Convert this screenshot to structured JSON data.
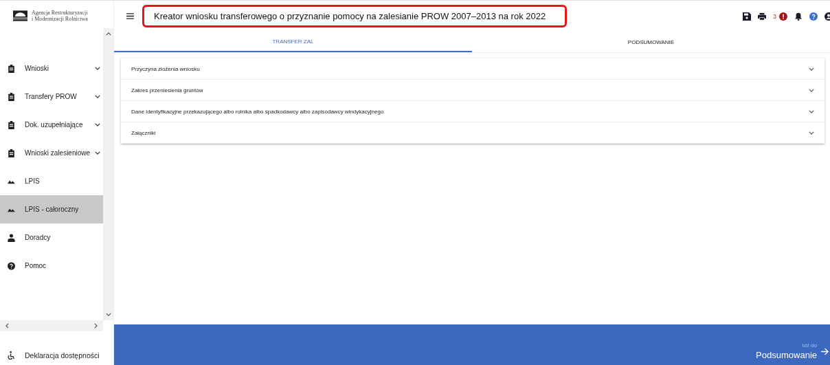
{
  "logo": {
    "line1": "Agencja Restrukturyzacji",
    "line2": "i Modernizacji Rolnictwa"
  },
  "sidebar": {
    "items": [
      {
        "label": "Wnioski",
        "kind": "clipboard",
        "expandable": true,
        "selected": false
      },
      {
        "label": "Transfery PROW",
        "kind": "clipboard",
        "expandable": true,
        "selected": false
      },
      {
        "label": "Dok. uzupełniające",
        "kind": "clipboard",
        "expandable": true,
        "selected": false
      },
      {
        "label": "Wnioski zalesieniowe",
        "kind": "clipboard",
        "expandable": true,
        "selected": false
      },
      {
        "label": "LPIS",
        "kind": "mountains",
        "expandable": false,
        "selected": false
      },
      {
        "label": "LPIS - całoroczny",
        "kind": "mountains",
        "expandable": false,
        "selected": true
      },
      {
        "label": "Doradcy",
        "kind": "person",
        "expandable": false,
        "selected": false
      },
      {
        "label": "Pomoc",
        "kind": "help",
        "expandable": false,
        "selected": false
      }
    ],
    "footer": {
      "label": "Deklaracja dostępności"
    }
  },
  "header": {
    "title": "Kreator wniosku transferowego o przyznanie pomocy na zalesianie PROW 2007–2013 na rok 2022",
    "notification_count": "3"
  },
  "tabs": [
    {
      "label": "TRANSFER ZAL",
      "selected": true
    },
    {
      "label": "PODSUMOWANIE",
      "selected": false
    }
  ],
  "sections": [
    {
      "title": "Przyczyna złożenia wniosku",
      "expanded": false
    },
    {
      "title": "Zakres przeniesienia gruntów",
      "expanded": false
    },
    {
      "title": "Dane identyfikacyjne przekazującego albo rolnika albo spadkodawcy albo zapisodawcy windykacyjnego",
      "expanded": false
    },
    {
      "title": "Załączniki",
      "expanded": false
    }
  ],
  "footer_bar": {
    "hint": "Idź do",
    "target": "Podsumowanie"
  }
}
